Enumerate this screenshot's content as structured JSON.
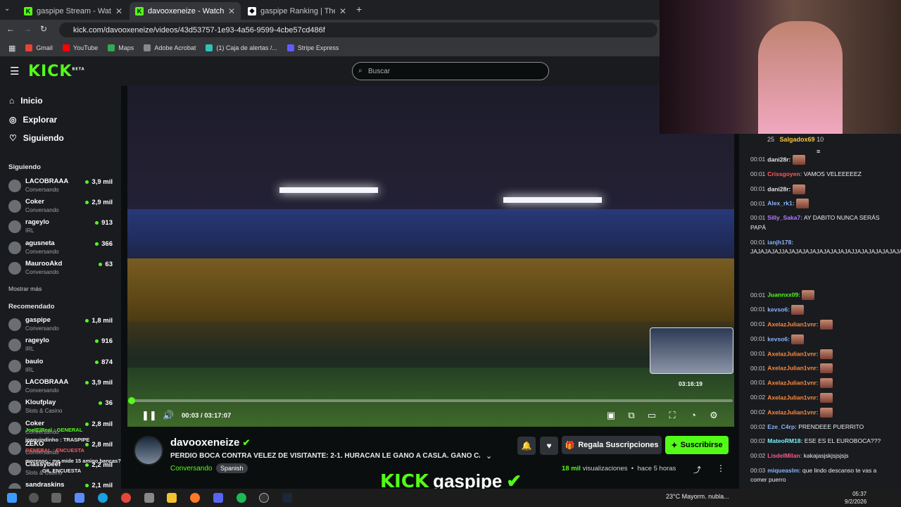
{
  "browser": {
    "tabs": [
      {
        "title": "gaspipe Stream - Watch Live on Kick",
        "active": false
      },
      {
        "title": "davooxeneize - Watch the VOD",
        "active": true
      },
      {
        "title": "gaspipe Ranking | The best Channels",
        "active": false
      }
    ],
    "url": "kick.com/davooxeneize/videos/43d53757-1e93-4a56-9599-4cbe57cd486f",
    "bookmarks": [
      "Gmail",
      "YouTube",
      "Maps",
      "Adobe Acrobat",
      "(1) Caja de alertas /...",
      "Stripe Express"
    ]
  },
  "header": {
    "logo": "KICK",
    "logo_badge": "BETA",
    "search_placeholder": "Buscar"
  },
  "sidebar": {
    "nav": [
      "Inicio",
      "Explorar",
      "Siguiendo"
    ],
    "following_title": "Siguiendo",
    "following": [
      {
        "name": "LACOBRAAA",
        "category": "Conversando",
        "viewers": "3,9 mil"
      },
      {
        "name": "Coker",
        "category": "Conversando",
        "viewers": "2,9 mil"
      },
      {
        "name": "rageylo",
        "category": "IRL",
        "viewers": "913"
      },
      {
        "name": "agusneta",
        "category": "Conversando",
        "viewers": "366"
      },
      {
        "name": "MaurooAkd",
        "category": "Conversando",
        "viewers": "63"
      }
    ],
    "show_more": "Mostrar más",
    "recommended_title": "Recomendado",
    "recommended": [
      {
        "name": "gaspipe",
        "category": "Conversando",
        "viewers": "1,8 mil"
      },
      {
        "name": "rageylo",
        "category": "IRL",
        "viewers": "916"
      },
      {
        "name": "baulo",
        "category": "IRL",
        "viewers": "874"
      },
      {
        "name": "LACOBRAAA",
        "category": "Conversando",
        "viewers": "3,9 mil"
      },
      {
        "name": "Kloufplay",
        "category": "Slots & Casino",
        "viewers": "36"
      },
      {
        "name": "Coker",
        "category": "Conversando",
        "viewers": "2,8 mil"
      },
      {
        "name": "ZEKO",
        "category": "Conversando",
        "viewers": "2,8 mil"
      },
      {
        "name": "Classybeef",
        "category": "Slots & Casino",
        "viewers": "2,2 mil"
      },
      {
        "name": "sandraskins",
        "category": "",
        "viewers": "2,1 mil"
      }
    ],
    "overlay_chat": [
      "JoelElReal : GENERAL",
      "joaquindinho : TRASPIPE",
      "GENERAL : ENCUESTA",
      "morenoc : me mide 15 amigo bancas?",
      "GIL ENCUESTA"
    ]
  },
  "player": {
    "current_time": "00:03",
    "duration": "03:17:07",
    "hover_time": "03:16:19",
    "progress_fraction": 0.0003
  },
  "video_info": {
    "streamer": "davooxeneize",
    "title": "PERDIO BOCA CONTRA VELEZ DE VISITANTE: 2-1. HURACAN LE GANO A CASLA. GANO CAI. G...",
    "category": "Conversando",
    "language": "Spanish",
    "views": "18 mil",
    "views_suffix": "visualizaciones",
    "ago": "hace 5 horas",
    "gift_label": "Regala Suscripciones",
    "subscribe_label": "Suscribirse"
  },
  "overlay": {
    "logo": "KICK",
    "name": "gaspipe"
  },
  "chat": {
    "top_counts": [
      "25",
      "Salgadox69",
      "10"
    ],
    "messages": [
      {
        "time": "00:01",
        "user": "dani28r:",
        "text": "",
        "color": "#e6e6e6",
        "emote": true
      },
      {
        "time": "00:01",
        "user": "Crissgoyen:",
        "text": "VAMOS VELEEEEEZ",
        "color": "#ff5a5a",
        "emote": false
      },
      {
        "time": "00:01",
        "user": "dani28r:",
        "text": "",
        "color": "#e6e6e6",
        "emote": true
      },
      {
        "time": "00:01",
        "user": "Alex_rk1:",
        "text": "",
        "color": "#8ab4ff",
        "emote": true
      },
      {
        "time": "00:01",
        "user": "Silly_Saka7:",
        "text": "AY DABITO NUNCA SERÁS PAPÁ",
        "color": "#b27cff",
        "emote": false
      },
      {
        "time": "00:01",
        "user": "ianjh178:",
        "text": "JAJAJAJAJJAJAJAJAJAJAJAJAJAJAJJAJAJAJAJAJAJAJAJAJAJAJAJAJAJAJAJAJAJAJAJAJAJAJAJAJAJAJAJAJAJAJAJAJAJAJAJAJAJAJAJAJAJAJAJAJAJAJAJAJAJAJA",
        "color": "#8ab4ff",
        "emote": false
      },
      {
        "time": "00:01",
        "user": "Juannxx09:",
        "text": "",
        "color": "#53fc18",
        "emote": true
      },
      {
        "time": "00:01",
        "user": "kevso6:",
        "text": "",
        "color": "#8ab4ff",
        "emote": true
      },
      {
        "time": "00:01",
        "user": "AxelazJulian1vnr:",
        "text": "",
        "color": "#ff8a3d",
        "emote": true
      },
      {
        "time": "00:01",
        "user": "kevso6:",
        "text": "",
        "color": "#8ab4ff",
        "emote": true
      },
      {
        "time": "00:01",
        "user": "AxelazJulian1vnr:",
        "text": "",
        "color": "#ff8a3d",
        "emote": true
      },
      {
        "time": "00:01",
        "user": "AxelazJulian1vnr:",
        "text": "",
        "color": "#ff8a3d",
        "emote": true
      },
      {
        "time": "00:01",
        "user": "AxelazJulian1vnr:",
        "text": "",
        "color": "#ff8a3d",
        "emote": true
      },
      {
        "time": "00:02",
        "user": "AxelazJulian1vnr:",
        "text": "",
        "color": "#ff8a3d",
        "emote": true
      },
      {
        "time": "00:02",
        "user": "AxelazJulian1vnr:",
        "text": "",
        "color": "#ff8a3d",
        "emote": true
      },
      {
        "time": "00:02",
        "user": "Eze_C4rp:",
        "text": "PRENDEEE PUERRITO",
        "color": "#8ab4ff",
        "emote": false
      },
      {
        "time": "00:02",
        "user": "MateoRM18:",
        "text": "ESE ES EL EUROBOCA???",
        "color": "#7cf0ff",
        "emote": false
      },
      {
        "time": "00:02",
        "user": "LisdelMilan:",
        "text": "kakajasjskjsjsjsjs",
        "color": "#ff5a8a",
        "emote": false
      },
      {
        "time": "00:03",
        "user": "miqueaslm:",
        "text": "que lindo descanso te vas a comer puerro",
        "color": "#8ab4ff",
        "emote": false
      }
    ]
  },
  "taskbar": {
    "weather": "23°C  Mayorm. nubla...",
    "time": "05:37",
    "date": "9/2/2026"
  }
}
